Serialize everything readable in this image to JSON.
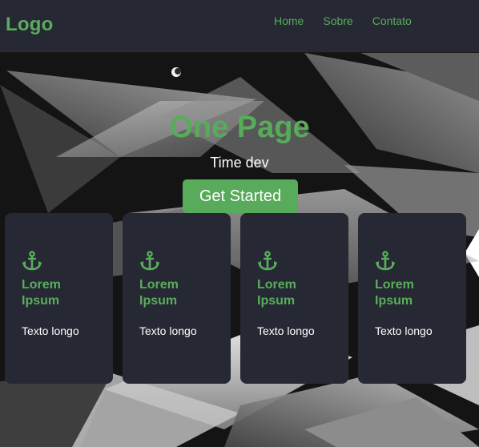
{
  "header": {
    "logo": "Logo",
    "nav": [
      {
        "label": "Home"
      },
      {
        "label": "Sobre"
      },
      {
        "label": "Contato"
      }
    ]
  },
  "hero": {
    "title": "One Page",
    "subtitle": "Time dev",
    "cta_label": "Get Started"
  },
  "cards": [
    {
      "icon": "anchor-icon",
      "title": "Lorem Ipsum",
      "text": "Texto longo"
    },
    {
      "icon": "anchor-icon",
      "title": "Lorem Ipsum",
      "text": "Texto longo"
    },
    {
      "icon": "anchor-icon",
      "title": "Lorem Ipsum",
      "text": "Texto longo"
    },
    {
      "icon": "anchor-icon",
      "title": "Lorem Ipsum",
      "text": "Texto longo"
    }
  ],
  "colors": {
    "accent": "#57ab5a",
    "header_bg": "#262833",
    "card_bg": "#262833",
    "text_light": "#ffffff"
  }
}
